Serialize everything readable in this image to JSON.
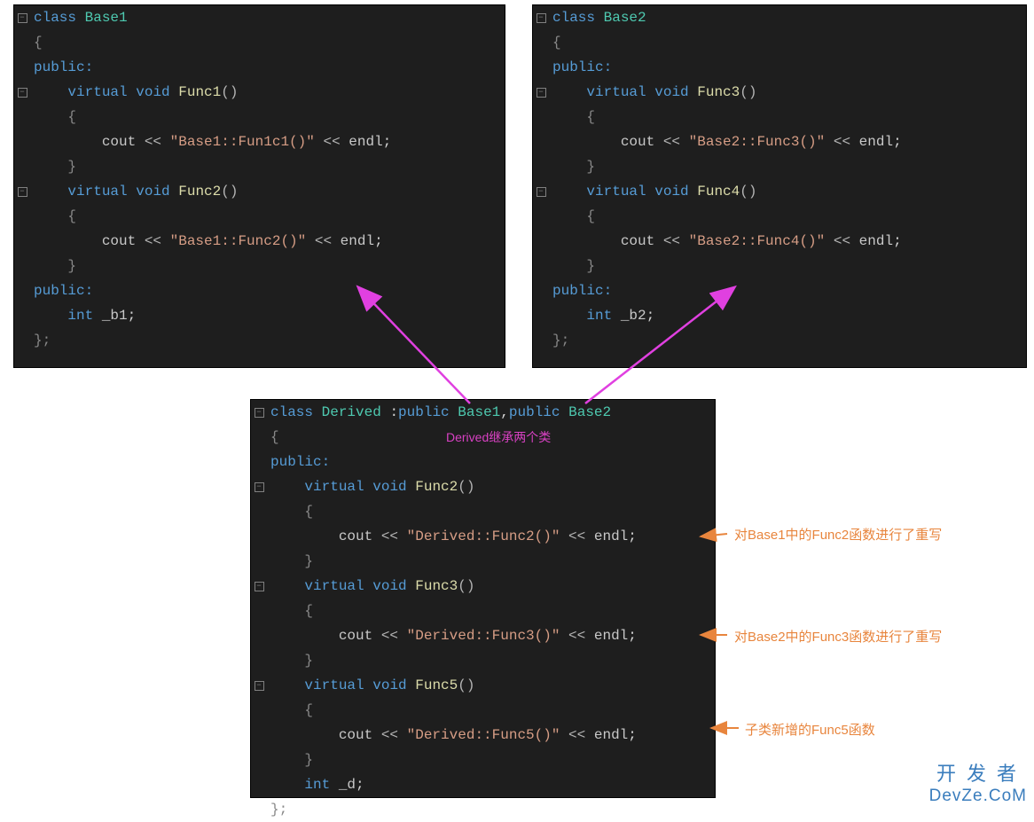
{
  "block1": {
    "class_keyword": "class",
    "class_name": "Base1",
    "public1": "public:",
    "virtual": "virtual",
    "void": "void",
    "func1_name": "Func1",
    "func1_parens": "()",
    "cout": "cout",
    "op_shift": " << ",
    "func1_string": "\"Base1::Fun1c1()\"",
    "endl": "endl",
    "semi": ";",
    "func2_name": "Func2",
    "func2_parens": "()",
    "func2_string": "\"Base1::Func2()\"",
    "public2": "public:",
    "int": "int",
    "member": "_b1"
  },
  "block2": {
    "class_keyword": "class",
    "class_name": "Base2",
    "public1": "public:",
    "virtual": "virtual",
    "void": "void",
    "func3_name": "Func3",
    "func3_parens": "()",
    "cout": "cout",
    "op_shift": " << ",
    "func3_string": "\"Base2::Func3()\"",
    "endl": "endl",
    "semi": ";",
    "func4_name": "Func4",
    "func4_parens": "()",
    "func4_string": "\"Base2::Func4()\"",
    "public2": "public:",
    "int": "int",
    "member": "_b2"
  },
  "block3": {
    "class_keyword": "class",
    "class_name": "Derived",
    "inherit_text": " :",
    "public_kw": "public",
    "base1": "Base1",
    "comma": ",",
    "base2": "Base2",
    "public_access": "public:",
    "virtual": "virtual",
    "void": "void",
    "func2_name": "Func2",
    "parens": "()",
    "cout": "cout",
    "op_shift": " << ",
    "func2_string": "\"Derived::Func2()\"",
    "endl": "endl",
    "semi": ";",
    "func3_name": "Func3",
    "func3_string": "\"Derived::Func3()\"",
    "func5_name": "Func5",
    "func5_string": "\"Derived::Func5()\"",
    "int": "int",
    "member": "_d",
    "inherit_label": "Derived继承两个类"
  },
  "annotations": {
    "func2_override": "对Base1中的Func2函数进行了重写",
    "func3_override": "对Base2中的Func3函数进行了重写",
    "func5_new": "子类新增的Func5函数"
  },
  "watermark": {
    "cn": "开发者",
    "en": "DevZe.CoM"
  },
  "symbols": {
    "open_brace": "{",
    "close_brace": "}",
    "close_brace_semi": "};"
  }
}
